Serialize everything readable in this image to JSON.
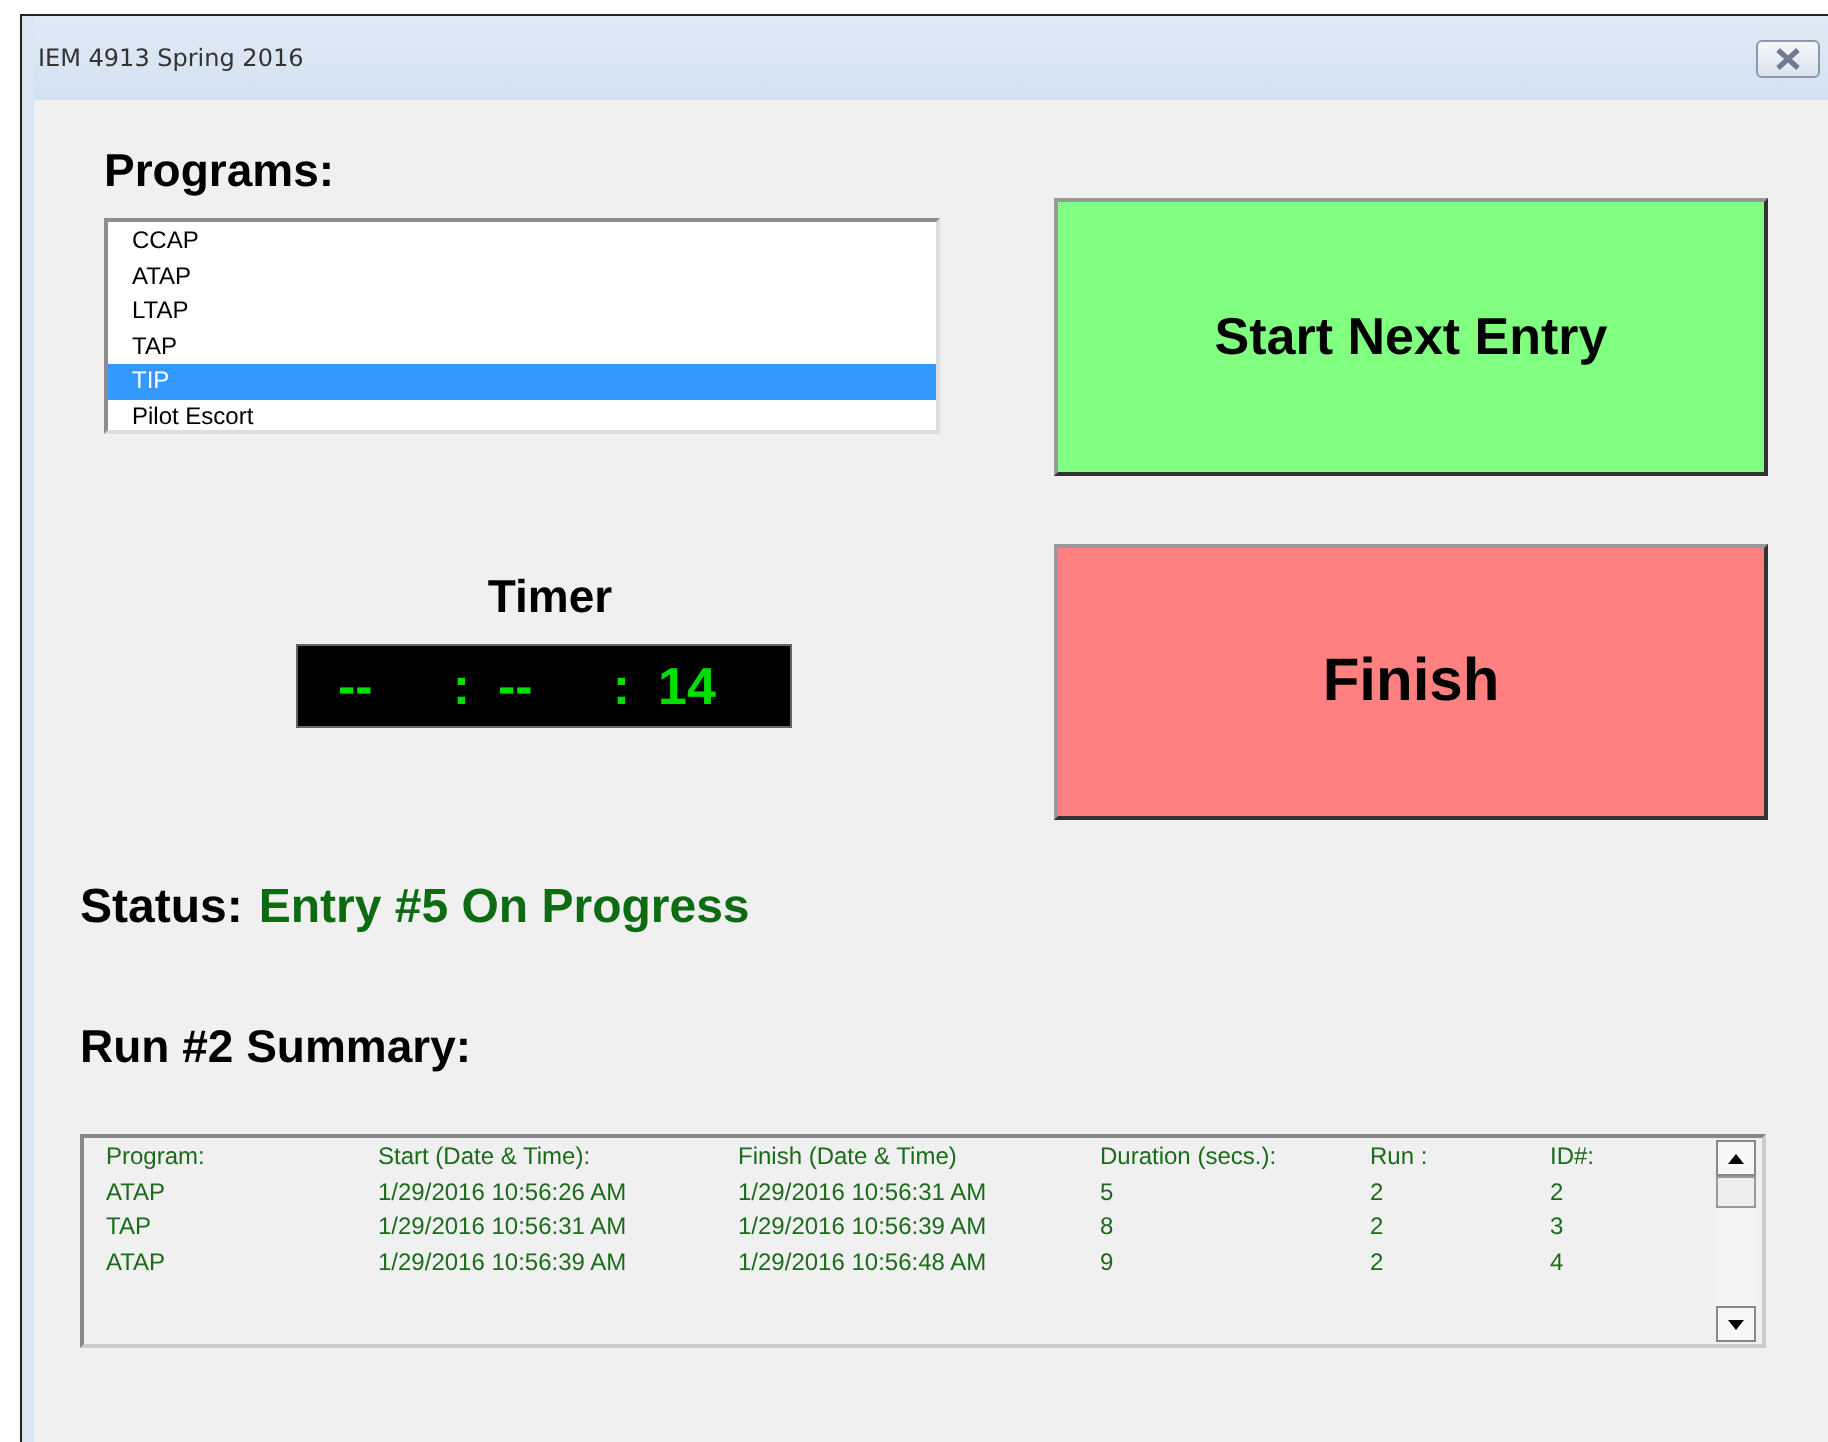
{
  "window": {
    "title": "IEM 4913 Spring 2016"
  },
  "programs": {
    "heading": "Programs:",
    "items": [
      {
        "label": "CCAP",
        "selected": false
      },
      {
        "label": "ATAP",
        "selected": false
      },
      {
        "label": "LTAP",
        "selected": false
      },
      {
        "label": "TAP",
        "selected": false
      },
      {
        "label": "TIP",
        "selected": true
      },
      {
        "label": "Pilot Escort",
        "selected": false
      }
    ]
  },
  "timer": {
    "label": "Timer",
    "parts": [
      "--",
      ":",
      "--",
      ":",
      "14"
    ]
  },
  "buttons": [
    {
      "label": "Start Next Entry",
      "kind": "start"
    },
    {
      "label": "Finish",
      "kind": "finish"
    }
  ],
  "status": {
    "label": "Status:",
    "value": "Entry #5 On Progress"
  },
  "summary": {
    "heading": "Run #2 Summary:",
    "table": {
      "columns": [
        "Program:",
        "Start (Date & Time):",
        "Finish (Date & Time)",
        "Duration (secs.):",
        "Run :",
        "ID#:"
      ],
      "rows": [
        [
          "ATAP",
          "1/29/2016 10:56:26 AM",
          "1/29/2016 10:56:31 AM",
          "5",
          "2",
          "2"
        ],
        [
          "TAP",
          "1/29/2016 10:56:31 AM",
          "1/29/2016 10:56:39 AM",
          "8",
          "2",
          "3"
        ],
        [
          "ATAP",
          "1/29/2016 10:56:39 AM",
          "1/29/2016 10:56:48 AM",
          "9",
          "2",
          "4"
        ]
      ]
    }
  }
}
